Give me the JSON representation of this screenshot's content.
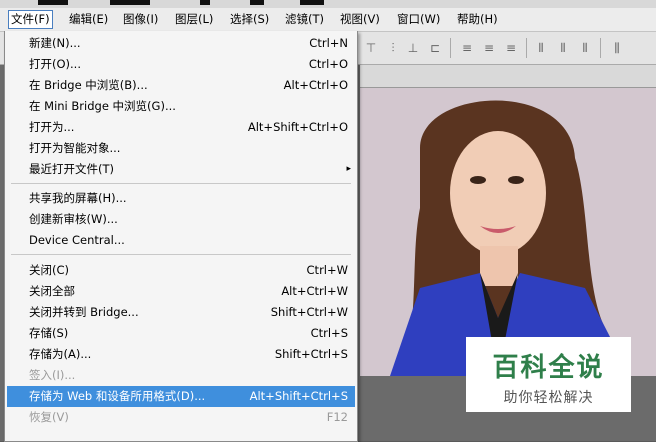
{
  "menubar": {
    "items": [
      {
        "label": "文件(F)"
      },
      {
        "label": "编辑(E)"
      },
      {
        "label": "图像(I)"
      },
      {
        "label": "图层(L)"
      },
      {
        "label": "选择(S)"
      },
      {
        "label": "滤镜(T)"
      },
      {
        "label": "视图(V)"
      },
      {
        "label": "窗口(W)"
      },
      {
        "label": "帮助(H)"
      }
    ]
  },
  "file_menu": {
    "items": [
      {
        "label": "新建(N)...",
        "shortcut": "Ctrl+N"
      },
      {
        "label": "打开(O)...",
        "shortcut": "Ctrl+O"
      },
      {
        "label": "在 Bridge 中浏览(B)...",
        "shortcut": "Alt+Ctrl+O"
      },
      {
        "label": "在 Mini Bridge 中浏览(G)...",
        "shortcut": ""
      },
      {
        "label": "打开为...",
        "shortcut": "Alt+Shift+Ctrl+O"
      },
      {
        "label": "打开为智能对象...",
        "shortcut": ""
      },
      {
        "label": "最近打开文件(T)",
        "shortcut": "",
        "submenu": "▸"
      },
      {
        "label": "共享我的屏幕(H)...",
        "shortcut": ""
      },
      {
        "label": "创建新审核(W)...",
        "shortcut": ""
      },
      {
        "label": "Device Central...",
        "shortcut": ""
      },
      {
        "label": "关闭(C)",
        "shortcut": "Ctrl+W"
      },
      {
        "label": "关闭全部",
        "shortcut": "Alt+Ctrl+W"
      },
      {
        "label": "关闭并转到 Bridge...",
        "shortcut": "Shift+Ctrl+W"
      },
      {
        "label": "存储(S)",
        "shortcut": "Ctrl+S"
      },
      {
        "label": "存储为(A)...",
        "shortcut": "Shift+Ctrl+S"
      },
      {
        "label": "签入(I)...",
        "shortcut": "",
        "disabled": true
      },
      {
        "label": "存储为 Web 和设备所用格式(D)...",
        "shortcut": "Alt+Shift+Ctrl+S",
        "highlighted": true
      },
      {
        "label": "恢复(V)",
        "shortcut": "F12",
        "disabled": true
      }
    ]
  },
  "watermark": {
    "title": "百科全说",
    "subtitle": "助你轻松解决"
  },
  "colors": {
    "highlight": "#3f8fdd",
    "watermark_green": "#2f7f4a"
  }
}
